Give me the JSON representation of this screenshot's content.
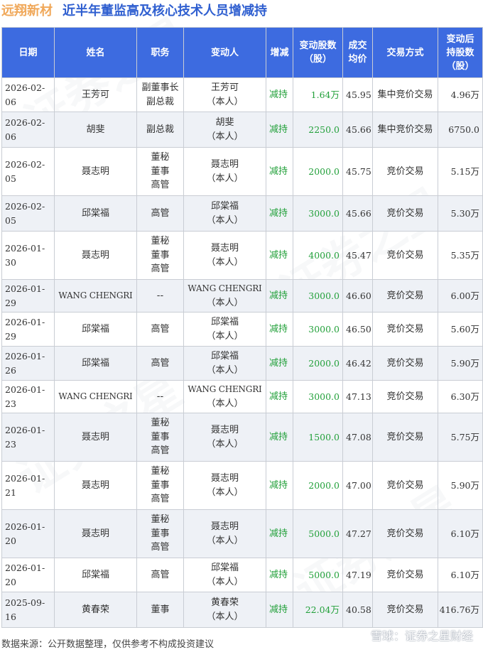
{
  "header": {
    "company": "远翔新材",
    "title": "近半年董监高及核心技术人员增减持"
  },
  "table": {
    "columns": [
      "日期",
      "姓名",
      "职务",
      "变动人",
      "增减",
      "变动股数\n（股）",
      "成交\n均价",
      "交易方式",
      "变动后\n持股数\n（股）"
    ],
    "rows": [
      {
        "date": "2026-02-06",
        "name": "王芳可",
        "position": "副董事长\n副总裁",
        "person": "王芳可\n（本人）",
        "direction": "减持",
        "shares": "1.64万",
        "price": "45.95",
        "method": "集中竞价交易",
        "after": "4.96万"
      },
      {
        "date": "2026-02-06",
        "name": "胡斐",
        "position": "副总裁",
        "person": "胡斐\n（本人）",
        "direction": "减持",
        "shares": "2250.0",
        "price": "45.66",
        "method": "集中竞价交易",
        "after": "6750.0"
      },
      {
        "date": "2026-02-05",
        "name": "聂志明",
        "position": "董秘\n董事\n高管",
        "person": "聂志明\n（本人）",
        "direction": "减持",
        "shares": "2000.0",
        "price": "45.75",
        "method": "竞价交易",
        "after": "5.15万"
      },
      {
        "date": "2026-02-05",
        "name": "邱棠福",
        "position": "高管",
        "person": "邱棠福\n（本人）",
        "direction": "减持",
        "shares": "3000.0",
        "price": "45.66",
        "method": "竞价交易",
        "after": "5.30万"
      },
      {
        "date": "2026-01-30",
        "name": "聂志明",
        "position": "董秘\n董事\n高管",
        "person": "聂志明\n（本人）",
        "direction": "减持",
        "shares": "4000.0",
        "price": "45.47",
        "method": "竞价交易",
        "after": "5.35万"
      },
      {
        "date": "2026-01-29",
        "name": "WANG CHENGRI",
        "position": "--",
        "person": "WANG CHENGRI\n（本人）",
        "direction": "减持",
        "shares": "3000.0",
        "price": "46.60",
        "method": "竞价交易",
        "after": "6.00万"
      },
      {
        "date": "2026-01-29",
        "name": "邱棠福",
        "position": "高管",
        "person": "邱棠福\n（本人）",
        "direction": "减持",
        "shares": "3000.0",
        "price": "46.50",
        "method": "竞价交易",
        "after": "5.60万"
      },
      {
        "date": "2026-01-26",
        "name": "邱棠福",
        "position": "高管",
        "person": "邱棠福\n（本人）",
        "direction": "减持",
        "shares": "2000.0",
        "price": "46.42",
        "method": "竞价交易",
        "after": "5.90万"
      },
      {
        "date": "2026-01-23",
        "name": "WANG CHENGRI",
        "position": "--",
        "person": "WANG CHENGRI\n（本人）",
        "direction": "减持",
        "shares": "3000.0",
        "price": "47.13",
        "method": "竞价交易",
        "after": "6.30万"
      },
      {
        "date": "2026-01-23",
        "name": "聂志明",
        "position": "董秘\n董事\n高管",
        "person": "聂志明\n（本人）",
        "direction": "减持",
        "shares": "1500.0",
        "price": "47.08",
        "method": "竞价交易",
        "after": "5.75万"
      },
      {
        "date": "2026-01-21",
        "name": "聂志明",
        "position": "董秘\n董事\n高管",
        "person": "聂志明\n（本人）",
        "direction": "减持",
        "shares": "2000.0",
        "price": "47.00",
        "method": "竞价交易",
        "after": "5.90万"
      },
      {
        "date": "2026-01-20",
        "name": "聂志明",
        "position": "董秘\n董事\n高管",
        "person": "聂志明\n（本人）",
        "direction": "减持",
        "shares": "5000.0",
        "price": "47.27",
        "method": "竞价交易",
        "after": "6.10万"
      },
      {
        "date": "2026-01-20",
        "name": "邱棠福",
        "position": "高管",
        "person": "邱棠福\n（本人）",
        "direction": "减持",
        "shares": "5000.0",
        "price": "47.19",
        "method": "竞价交易",
        "after": "6.10万"
      },
      {
        "date": "2025-09-16",
        "name": "黄春荣",
        "position": "董事",
        "person": "黄春荣\n（本人）",
        "direction": "减持",
        "shares": "22.04万",
        "price": "40.58",
        "method": "竞价交易",
        "after": "416.76万"
      }
    ]
  },
  "footer": {
    "source": "数据来源：公开数据整理，仅供参考不构成投资建议",
    "brand": "雪球：证券之星财经"
  },
  "colors": {
    "header_bg": "#3d6be0",
    "title_blue": "#2f5fd0",
    "company_orange": "#f0a85a",
    "decrease_green": "#22a03a",
    "stripe": "#eef1f6"
  },
  "icons": {
    "brand": "snowball-logo-icon"
  }
}
